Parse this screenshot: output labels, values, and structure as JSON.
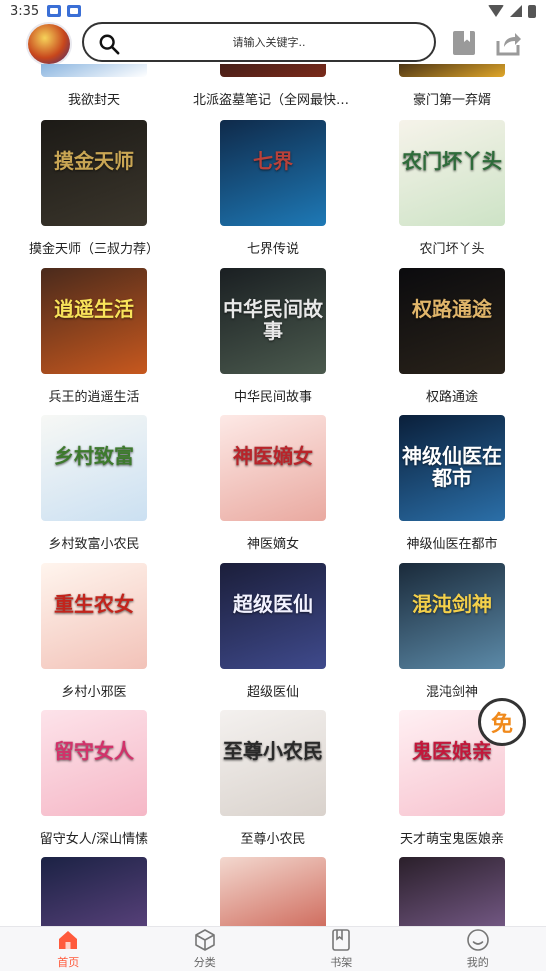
{
  "status_bar": {
    "time": "3:35"
  },
  "search": {
    "placeholder": "请输入关键字.."
  },
  "partial_row": [
    {
      "title": "我欲封天",
      "colors": [
        "#6fa3d8",
        "#ffffff"
      ]
    },
    {
      "title": "北派盗墓笔记（全网最快，...",
      "colors": [
        "#3a1d18",
        "#7a2a1a"
      ]
    },
    {
      "title": "豪门第一弃婿",
      "colors": [
        "#2a1a10",
        "#e0a72a"
      ]
    }
  ],
  "books": [
    {
      "title": "摸金天师（三叔力荐）",
      "cover_text": "摸金天师",
      "colors": [
        "#1c1a16",
        "#3b362c"
      ],
      "accent": "#c9a654"
    },
    {
      "title": "七界传说",
      "cover_text": "七界",
      "colors": [
        "#0f2a4a",
        "#1e79b6"
      ],
      "accent": "#b8413a"
    },
    {
      "title": "农门坏丫头",
      "cover_text": "农门坏丫头",
      "colors": [
        "#f6f3ea",
        "#cde3c6"
      ],
      "accent": "#2e6c3a"
    },
    {
      "title": "兵王的逍遥生活",
      "cover_text": "逍遥生活",
      "colors": [
        "#4a2a1c",
        "#c7581e"
      ],
      "accent": "#f8e35a"
    },
    {
      "title": "中华民间故事",
      "cover_text": "中华民间故事",
      "colors": [
        "#1a1f22",
        "#4b5a4e"
      ],
      "accent": "#e8e8e8"
    },
    {
      "title": "权路通途",
      "cover_text": "权路通途",
      "colors": [
        "#0b0b0e",
        "#2a231a"
      ],
      "accent": "#e0b56a"
    },
    {
      "title": "乡村致富小农民",
      "cover_text": "乡村致富",
      "colors": [
        "#f7f8f5",
        "#cbe0f2"
      ],
      "accent": "#3e7a2e"
    },
    {
      "title": "神医嫡女",
      "cover_text": "神医嫡女",
      "colors": [
        "#fde9e6",
        "#e9a9a0"
      ],
      "accent": "#b8242a"
    },
    {
      "title": "神级仙医在都市",
      "cover_text": "神级仙医在都市",
      "colors": [
        "#0a1f3a",
        "#2b6fa8"
      ],
      "accent": "#ffffff"
    },
    {
      "title": "乡村小邪医",
      "cover_text": "重生农女",
      "colors": [
        "#fff5ee",
        "#f2c2b8"
      ],
      "accent": "#c3241c"
    },
    {
      "title": "超级医仙",
      "cover_text": "超级医仙",
      "colors": [
        "#1b1e3a",
        "#3f4a8c"
      ],
      "accent": "#f2f2ff"
    },
    {
      "title": "混沌剑神",
      "cover_text": "混沌剑神",
      "colors": [
        "#1a2a3a",
        "#5c8aa8"
      ],
      "accent": "#f4d04a"
    },
    {
      "title": "留守女人/深山情愫",
      "cover_text": "留守女人",
      "colors": [
        "#fde3ea",
        "#f5b7c6"
      ],
      "accent": "#d2326a"
    },
    {
      "title": "至尊小农民",
      "cover_text": "至尊小农民",
      "colors": [
        "#f4f1ef",
        "#d9d2cc"
      ],
      "accent": "#2a2a2a"
    },
    {
      "title": "天才萌宝鬼医娘亲",
      "cover_text": "鬼医娘亲",
      "colors": [
        "#fff0f3",
        "#f7c3cf"
      ],
      "accent": "#c2183b"
    }
  ],
  "bottom_partial": [
    {
      "colors": [
        "#1b2244",
        "#6a4a8a"
      ]
    },
    {
      "colors": [
        "#f3d8cf",
        "#c44a3a"
      ]
    },
    {
      "colors": [
        "#2a1f2a",
        "#8a6aa0"
      ]
    }
  ],
  "free_badge": {
    "label": "免"
  },
  "bottom_nav": [
    {
      "label": "首页",
      "icon": "home-icon",
      "active": true
    },
    {
      "label": "分类",
      "icon": "cube-icon",
      "active": false
    },
    {
      "label": "书架",
      "icon": "book-icon",
      "active": false
    },
    {
      "label": "我的",
      "icon": "smile-icon",
      "active": false
    }
  ],
  "colors": {
    "accent": "#ff5a3c",
    "nav_bg": "#f7f7f9"
  }
}
